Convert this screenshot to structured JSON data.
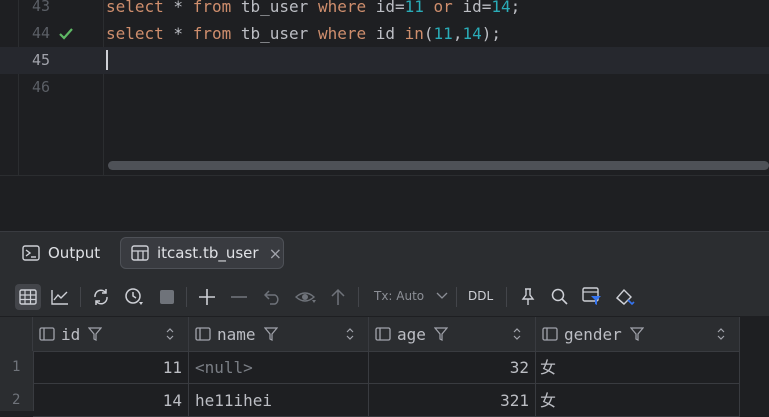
{
  "editor": {
    "lines": [
      {
        "num": "43",
        "tokens": [
          {
            "t": "select",
            "c": "kw"
          },
          {
            "t": " * ",
            "c": ""
          },
          {
            "t": "from",
            "c": "kw"
          },
          {
            "t": " tb_user ",
            "c": ""
          },
          {
            "t": "where",
            "c": "kw"
          },
          {
            "t": " id=",
            "c": ""
          },
          {
            "t": "11",
            "c": "num"
          },
          {
            "t": " ",
            "c": ""
          },
          {
            "t": "or",
            "c": "kw"
          },
          {
            "t": " id=",
            "c": ""
          },
          {
            "t": "14",
            "c": "num"
          },
          {
            "t": ";",
            "c": ""
          }
        ]
      },
      {
        "num": "44",
        "tokens": [
          {
            "t": "select",
            "c": "kw"
          },
          {
            "t": " * ",
            "c": ""
          },
          {
            "t": "from",
            "c": "kw"
          },
          {
            "t": " tb_user ",
            "c": ""
          },
          {
            "t": "where",
            "c": "kw"
          },
          {
            "t": " id ",
            "c": ""
          },
          {
            "t": "in",
            "c": "kw"
          },
          {
            "t": "(",
            "c": ""
          },
          {
            "t": "11",
            "c": "num"
          },
          {
            "t": ",",
            "c": ""
          },
          {
            "t": "14",
            "c": "num"
          },
          {
            "t": ");",
            "c": ""
          }
        ]
      },
      {
        "num": "45",
        "tokens": []
      },
      {
        "num": "46",
        "tokens": []
      }
    ]
  },
  "tabs": [
    {
      "label": "Output",
      "icon": "output-console-icon"
    },
    {
      "label": "itcast.tb_user",
      "icon": "table-icon",
      "close": "×"
    }
  ],
  "toolbar": {
    "tx_mode": "Tx: Auto",
    "ddl_label": "DDL",
    "icons": [
      "table-view-icon",
      "chart-view-icon",
      "refresh-icon",
      "history-icon",
      "stop-icon",
      "add-row-icon",
      "delete-row-icon",
      "revert-icon",
      "preview-changes-icon",
      "submit-icon",
      "pin-icon",
      "search-icon",
      "filter-table-icon",
      "clear-format-icon"
    ]
  },
  "grid": {
    "columns": [
      "id",
      "name",
      "age",
      "gender"
    ],
    "rows": [
      {
        "row": "1",
        "id": "11",
        "name": "<null>",
        "age": "32",
        "gender": "女"
      },
      {
        "row": "2",
        "id": "14",
        "name": "he11ihei",
        "age": "321",
        "gender": "女"
      }
    ]
  },
  "colors": {
    "keyword": "#cf8e6d",
    "number": "#2aacb8",
    "check": "#5fb865",
    "background": "#1e1f22"
  }
}
